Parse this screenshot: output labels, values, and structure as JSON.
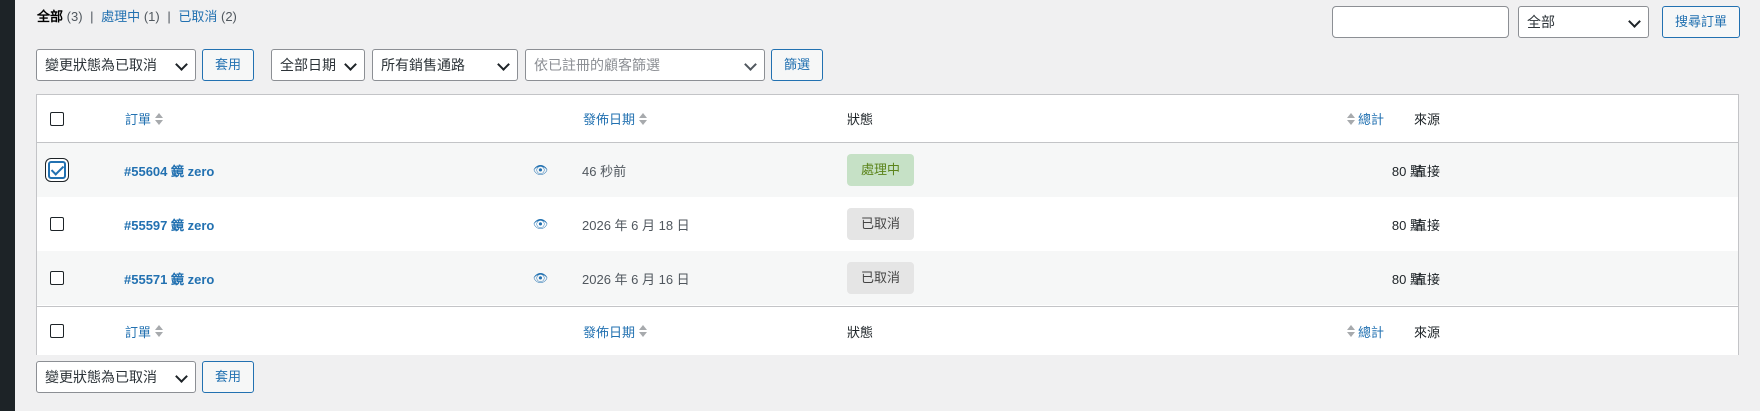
{
  "status_filters": {
    "all": {
      "label": "全部",
      "count": "(3)"
    },
    "processing": {
      "label": "處理中",
      "count": "(1)"
    },
    "cancelled": {
      "label": "已取消",
      "count": "(2)"
    },
    "separator": "|"
  },
  "search": {
    "value": "",
    "type_selected": "全部",
    "button": "搜尋訂單"
  },
  "top_actions": {
    "bulk_action": "變更狀態為已取消",
    "apply": "套用",
    "date_filter": "全部日期",
    "channel_filter": "所有銷售通路",
    "customer_filter_placeholder": "依已註冊的顧客篩選",
    "filter_button": "篩選"
  },
  "columns": {
    "order": "訂單",
    "date": "發佈日期",
    "status": "狀態",
    "total": "總計",
    "origin": "來源"
  },
  "orders": [
    {
      "id": "#55604 鏡 zero",
      "date": "46 秒前",
      "status": "處理中",
      "status_type": "processing",
      "total": "80 點",
      "origin": "直接",
      "checked": true
    },
    {
      "id": "#55597 鏡 zero",
      "date": "2026 年 6 月 18 日",
      "status": "已取消",
      "status_type": "cancelled",
      "total": "80 點",
      "origin": "直接",
      "checked": false
    },
    {
      "id": "#55571 鏡 zero",
      "date": "2026 年 6 月 16 日",
      "status": "已取消",
      "status_type": "cancelled",
      "total": "80 點",
      "origin": "直接",
      "checked": false
    }
  ],
  "bottom_actions": {
    "bulk_action": "變更狀態為已取消",
    "apply": "套用"
  },
  "icons": {
    "preview": "eye-icon",
    "sort": "sort-arrows-icon",
    "dropdown": "chevron-down-icon"
  },
  "colors": {
    "link": "#2271b1",
    "processing_bg": "#c6e1c6",
    "processing_fg": "#5b841b",
    "cancelled_bg": "#e5e5e5",
    "cancelled_fg": "#454545"
  }
}
